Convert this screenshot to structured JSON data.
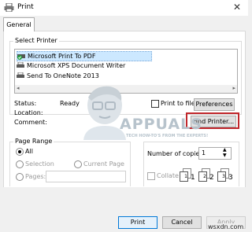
{
  "window": {
    "title": "Print",
    "close_glyph": "✕"
  },
  "tabs": [
    {
      "label": "General"
    }
  ],
  "select_printer": {
    "group_label": "Select Printer",
    "printers": [
      {
        "name": "Microsoft Print To PDF",
        "selected": true,
        "icon": "default-printer-icon"
      },
      {
        "name": "Microsoft XPS Document Writer",
        "selected": false,
        "icon": "printer-icon"
      },
      {
        "name": "Send To OneNote 2013",
        "selected": false,
        "icon": "printer-icon"
      }
    ],
    "status_label": "Status:",
    "status_value": "Ready",
    "location_label": "Location:",
    "comment_label": "Comment:",
    "print_to_file_label": "Print to file",
    "preferences_label": "Preferences",
    "find_printer_label": "Find Printer..."
  },
  "page_range": {
    "group_label": "Page Range",
    "all_label": "All",
    "selection_label": "Selection",
    "current_page_label": "Current Page",
    "pages_label": "Pages:",
    "selected": "All"
  },
  "copies": {
    "number_label": "Number of copies:",
    "number_value": "1",
    "collate_label": "Collate",
    "collate_pages": [
      "1",
      "1",
      "2",
      "2",
      "3",
      "3"
    ]
  },
  "watermark": {
    "brand": "APPUALS",
    "tagline": "TECH HOW-TO'S FROM THE EXPERTS!"
  },
  "footer": {
    "print_label": "Print",
    "cancel_label": "Cancel",
    "apply_label": "Apply",
    "site": "wsxdn.com"
  },
  "colors": {
    "highlight_box": "#c0262b",
    "selection_bg": "#cce8ff",
    "default_check": "#1f9e3a"
  }
}
